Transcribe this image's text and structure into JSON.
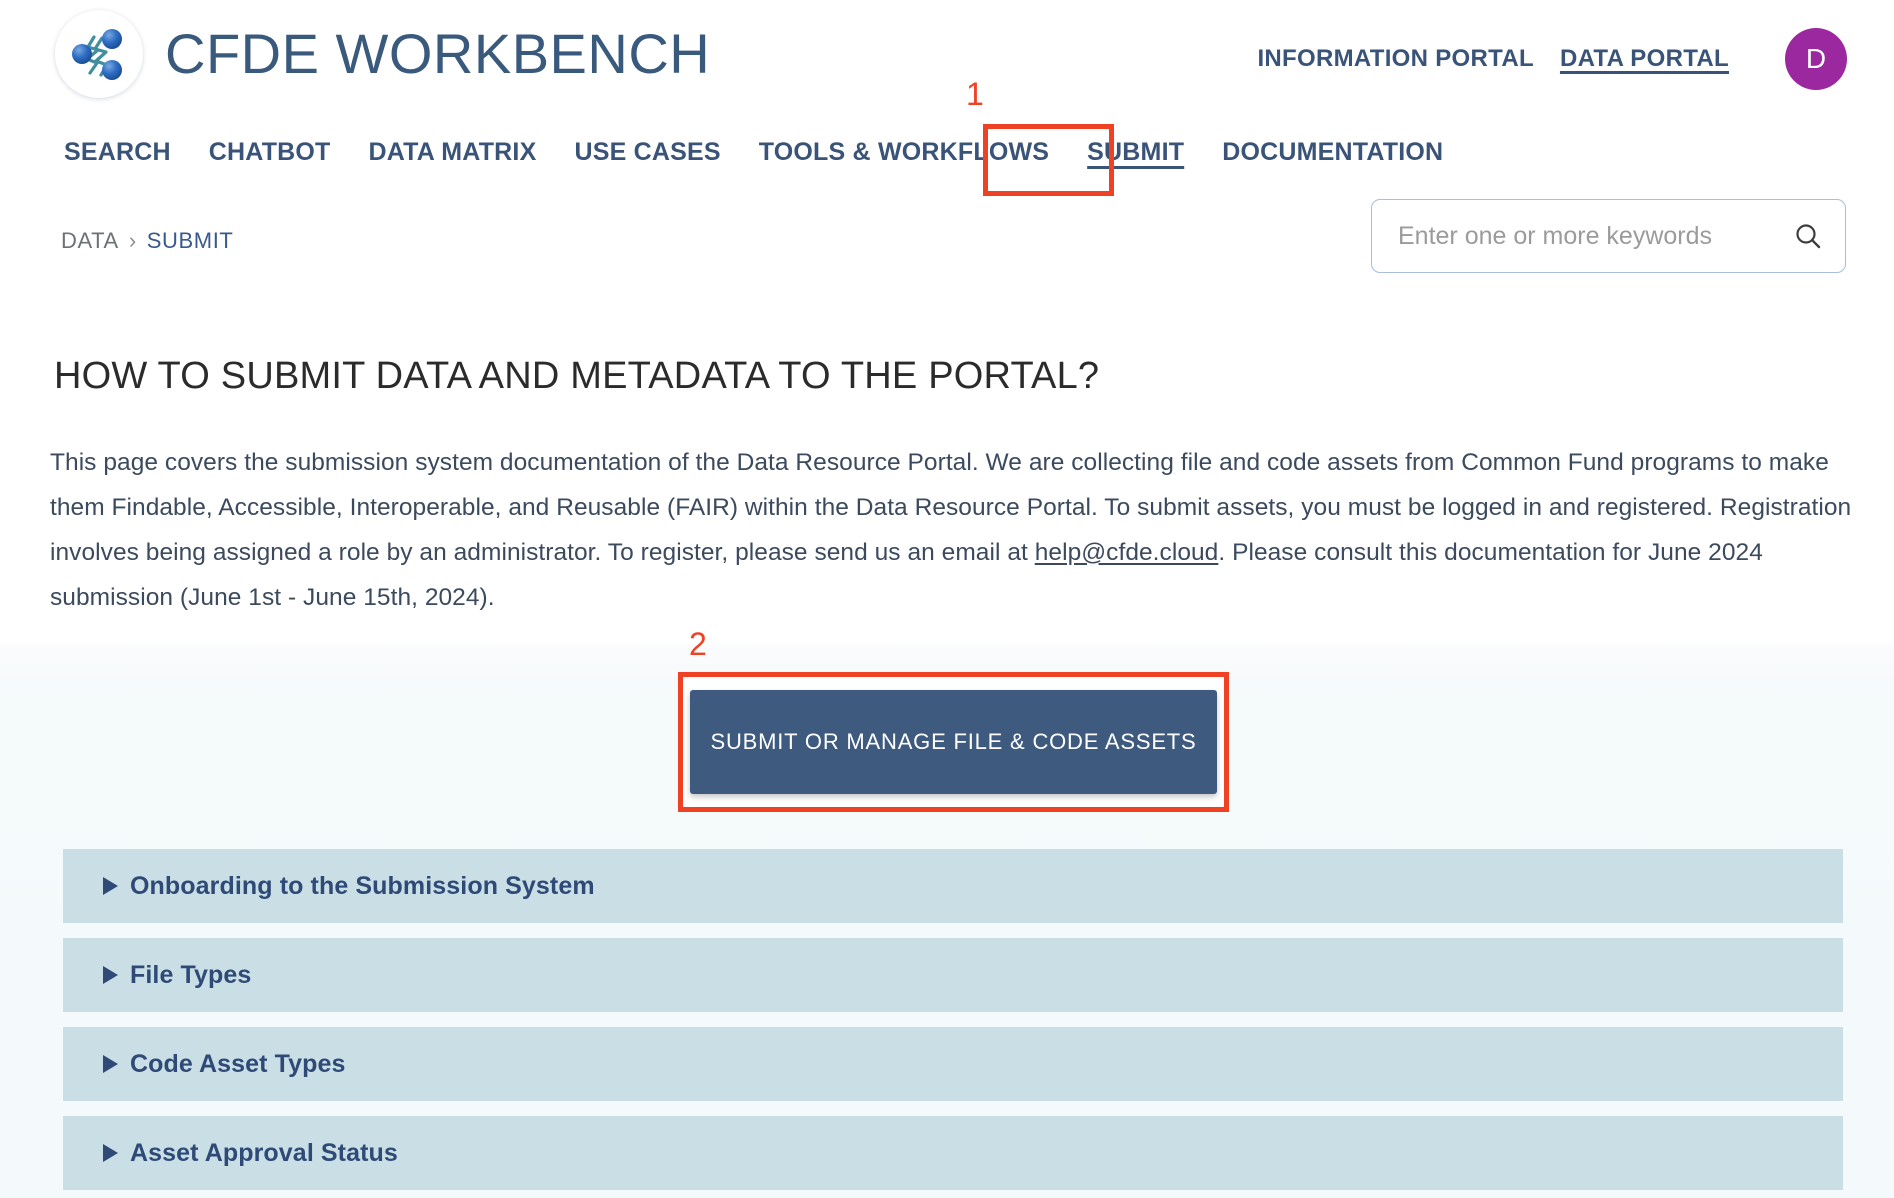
{
  "brand": {
    "title": "CFDE WORKBENCH",
    "logo_icon": "molecule-logo-icon"
  },
  "header": {
    "links": [
      {
        "label": "INFORMATION PORTAL",
        "active": false
      },
      {
        "label": "DATA PORTAL",
        "active": true
      }
    ],
    "avatar_initial": "D"
  },
  "mainnav": {
    "items": [
      {
        "label": "SEARCH",
        "current": false
      },
      {
        "label": "CHATBOT",
        "current": false
      },
      {
        "label": "DATA MATRIX",
        "current": false
      },
      {
        "label": "USE CASES",
        "current": false
      },
      {
        "label": "TOOLS & WORKFLOWS",
        "current": false
      },
      {
        "label": "SUBMIT",
        "current": true
      },
      {
        "label": "DOCUMENTATION",
        "current": false
      }
    ]
  },
  "annotations": [
    {
      "number": "1",
      "target": "submit-nav-item"
    },
    {
      "number": "2",
      "target": "submit-or-manage-assets-button"
    }
  ],
  "breadcrumb": {
    "root": "DATA",
    "separator": "›",
    "current": "SUBMIT"
  },
  "search": {
    "placeholder": "Enter one or more keywords",
    "value": "",
    "icon": "search-icon"
  },
  "main": {
    "title": "HOW TO SUBMIT DATA AND METADATA TO THE PORTAL?",
    "intro_part1": "This page covers the submission system documentation of the Data Resource Portal. We are collecting file and code assets from Common Fund programs to make them Findable, Accessible, Interoperable, and Reusable (FAIR) within the Data Resource Portal. To submit assets, you must be logged in and registered. Registration involves being assigned a role by an administrator. To register, please send us an email at ",
    "intro_email": "help@cfde.cloud",
    "intro_part2": ". Please consult this documentation for June 2024 submission (June 1st - June 15th, 2024).",
    "cta_label": "SUBMIT OR MANAGE FILE & CODE ASSETS"
  },
  "accordions": [
    {
      "label": "Onboarding to the Submission System",
      "expanded": false
    },
    {
      "label": "File Types",
      "expanded": false
    },
    {
      "label": "Code Asset Types",
      "expanded": false
    },
    {
      "label": "Asset Approval Status",
      "expanded": false
    }
  ],
  "colors": {
    "brand_blue": "#3a5a7d",
    "nav_blue": "#3a5379",
    "accent_red": "#ef4123",
    "button_blue": "#3e5a7e",
    "accordion_bg": "#c9dfe5",
    "accordion_text": "#2f4a77",
    "avatar_purple": "#9c28a0"
  }
}
